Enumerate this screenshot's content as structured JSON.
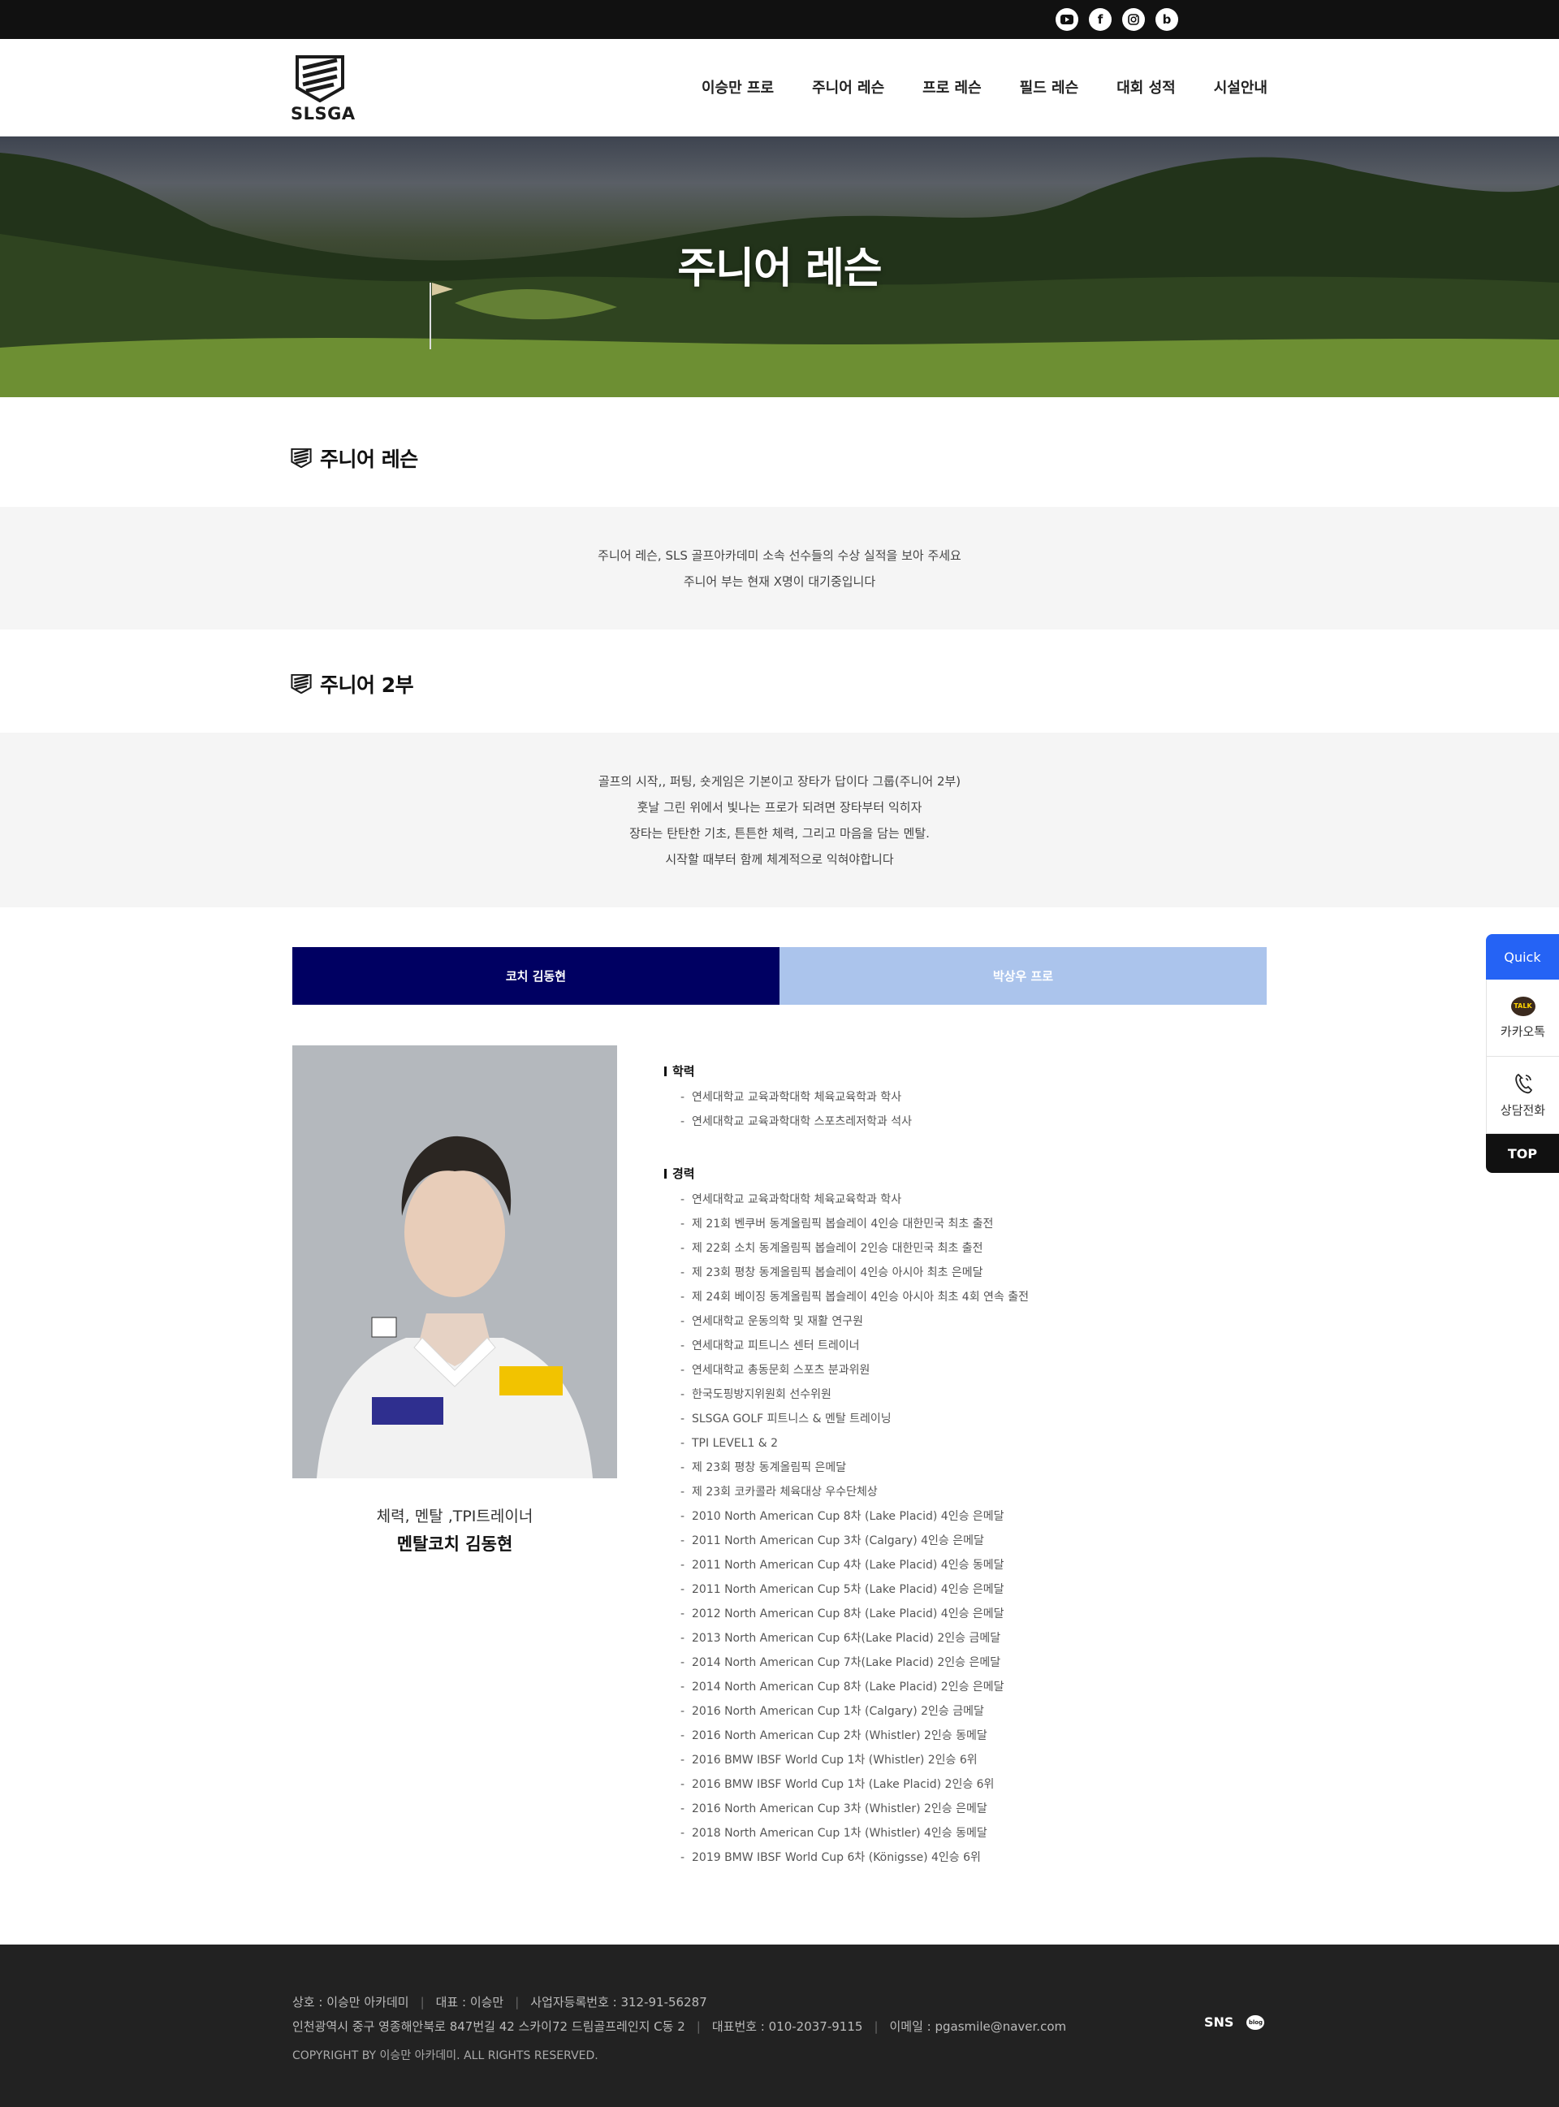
{
  "topbar": {
    "sns_icons": [
      "youtube-icon",
      "facebook-icon",
      "instagram-icon",
      "blog-icon"
    ]
  },
  "header": {
    "logo_text": "SLSGA",
    "nav": [
      "이승만 프로",
      "주니어 레슨",
      "프로 레슨",
      "필드 레슨",
      "대회 성적",
      "시설안내"
    ]
  },
  "hero": {
    "title": "주니어 레슨"
  },
  "section1": {
    "title": "주니어 레슨",
    "lines": [
      "주니어 레슨, SLS 골프아카데미 소속 선수들의 수상 실적을 보아 주세요",
      "주니어 부는 현재 X명이 대기중입니다"
    ]
  },
  "section2": {
    "title": "주니어 2부",
    "lines": [
      "골프의 시작,, 퍼팅, 숏게임은 기본이고 장타가 답이다 그룹(주니어 2부)",
      "훗날 그린 위에서 빛나는 프로가 되려면 장타부터 익히자",
      "장타는 탄탄한 기초, 튼튼한 체력, 그리고 마음을 담는 멘탈.",
      "시작할 때부터 함께 체계적으로 익혀야합니다"
    ]
  },
  "tabs": [
    "코치 김동현",
    "박상우 프로"
  ],
  "profile": {
    "role": "체력, 멘탈 ,TPI트레이너",
    "name": "멘탈코치  김동현",
    "education_title": "학력",
    "education": [
      "연세대학교 교육과학대학 체육교육학과 학사",
      "연세대학교 교육과학대학 스포츠레저학과 석사"
    ],
    "career_title": "경력",
    "career": [
      "연세대학교 교육과학대학 체육교육학과 학사",
      "제 21회 벤쿠버 동계올림픽 봅슬레이 4인승 대한민국 최초 출전",
      "제 22회 소치 동계올림픽 봅슬레이 2인승 대한민국 최초 출전",
      "제 23회 평창 동계올림픽 봅슬레이 4인승 아시아 최초 은메달",
      "제 24회 베이징 동계올림픽 봅슬레이 4인승 아시아 최초 4회 연속 출전",
      "연세대학교 운동의학 및 재활 연구원",
      "연세대학교 피트니스 센터 트레이너",
      "연세대학교 총동문회 스포츠 분과위원",
      "한국도핑방지위원회 선수위원",
      "SLSGA GOLF 피트니스 & 멘탈 트레이닝",
      "TPI LEVEL1 & 2",
      "제 23회 평창 동계올림픽 은메달",
      "제 23회 코카콜라 체육대상 우수단체상",
      "2010 North American Cup 8차 (Lake Placid) 4인승 은메달",
      "2011 North American Cup 3차 (Calgary) 4인승 은메달",
      "2011 North American Cup 4차 (Lake Placid) 4인승 동메달",
      "2011 North American Cup 5차 (Lake Placid) 4인승 은메달",
      "2012 North American Cup 8차 (Lake Placid) 4인승 은메달",
      "2013 North American Cup 6차(Lake Placid) 2인승 금메달",
      "2014 North American Cup 7차(Lake Placid) 2인승 은메달",
      "2014 North American Cup 8차 (Lake Placid) 2인승 은메달",
      "2016 North American Cup 1차 (Calgary) 2인승 금메달",
      "2016 North American Cup 2차 (Whistler) 2인승 동메달",
      "2016 BMW IBSF World Cup 1차 (Whistler) 2인승 6위",
      "2016 BMW IBSF World Cup 1차 (Lake Placid) 2인승 6위",
      "2016 North American Cup 3차 (Whistler) 2인승 은메달",
      "2018 North American Cup 1차 (Whistler) 4인승 동메달",
      "2019 BMW IBSF World Cup 6차 (Königsse) 4인승 6위"
    ]
  },
  "quick": {
    "title": "Quick",
    "kakao": "카카오톡",
    "kakao_badge": "TALK",
    "call": "상담전화",
    "top": "TOP"
  },
  "footer": {
    "company": "상호 : 이승만 아카데미",
    "ceo": "대표 : 이승만",
    "biz_no": "사업자등록번호 : 312-91-56287",
    "address": "인천광역시 중구 영종해안북로 847번길 42 스카이72 드림골프레인지 C동 2",
    "phone": "대표번호 : 010-2037-9115",
    "email": "이메일 : pgasmile@naver.com",
    "copyright": "COPYRIGHT BY 이승만 아카데미. ALL RIGHTS RESERVED.",
    "sns_label": "SNS",
    "blog_badge": "blog"
  },
  "colors": {
    "tab_active": "#000062",
    "tab_inactive": "#abc4ec",
    "quick_accent": "#2563f5",
    "footer_bg": "#222222"
  }
}
